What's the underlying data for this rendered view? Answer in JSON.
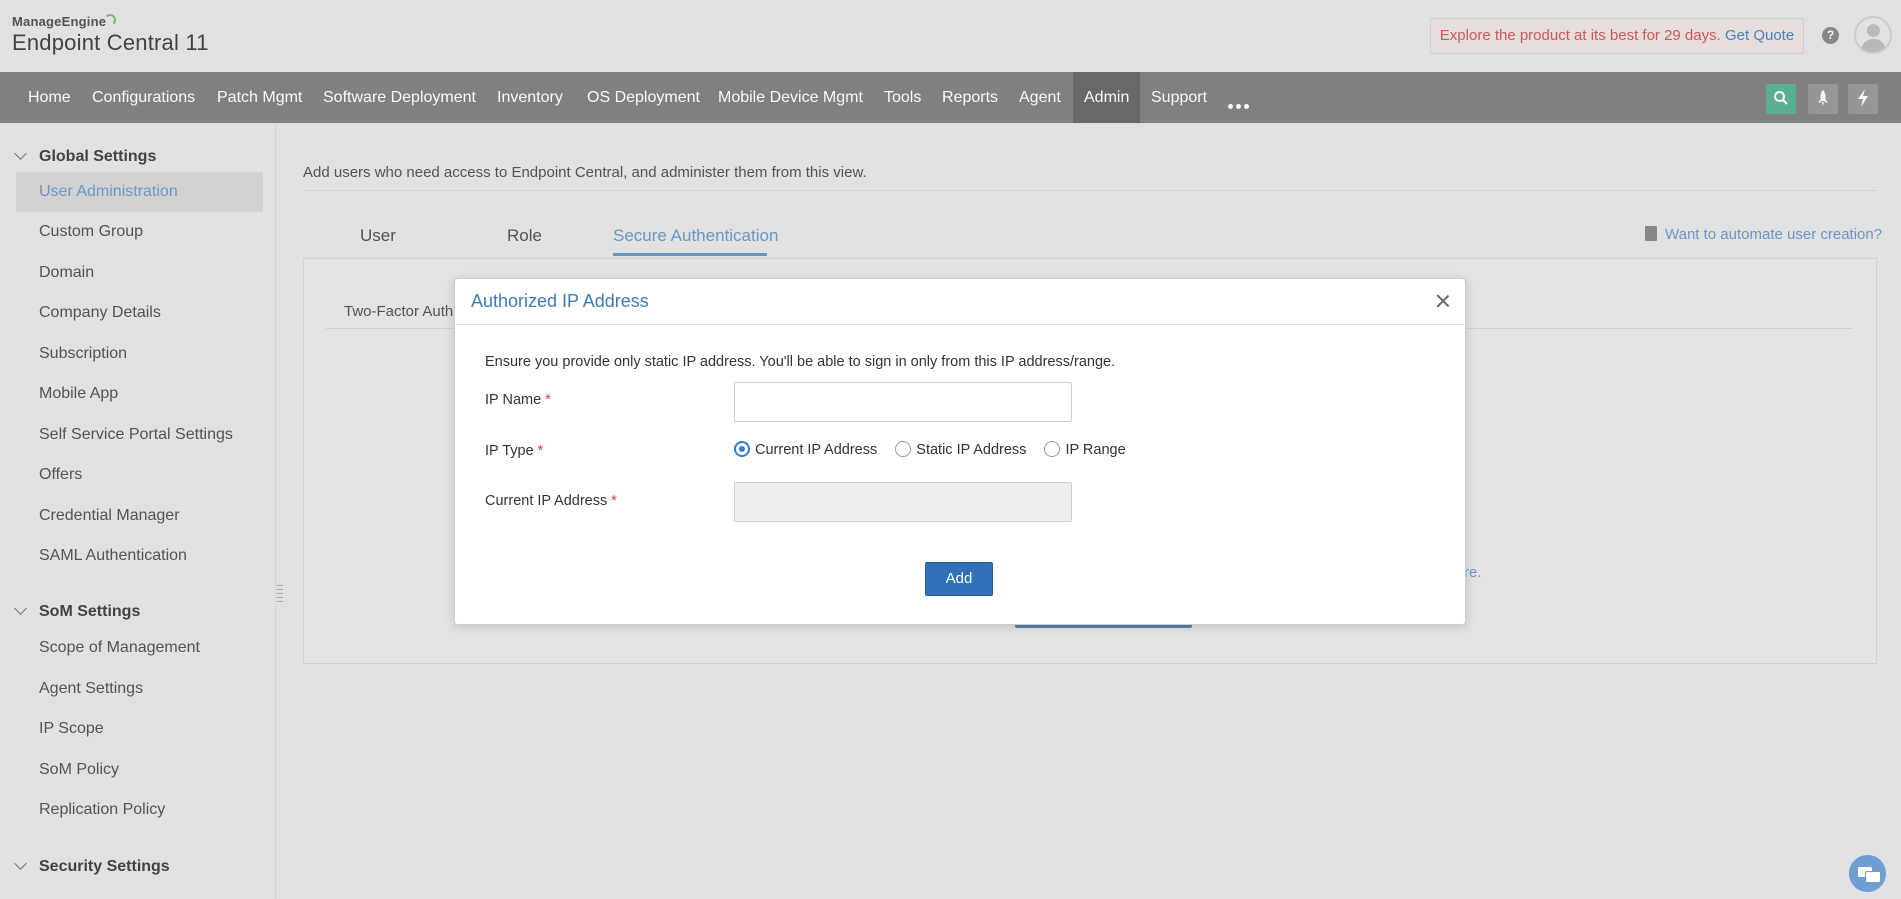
{
  "header": {
    "brand_small": "ManageEngine",
    "product_title": "Endpoint Central 11",
    "trial_text": "Explore the product at its best for 29 days.",
    "trial_link": "Get Quote",
    "help_glyph": "?"
  },
  "nav": {
    "items": [
      {
        "label": "Home"
      },
      {
        "label": "Configurations"
      },
      {
        "label": "Patch Mgmt"
      },
      {
        "label": "Software Deployment"
      },
      {
        "label": "Inventory"
      },
      {
        "label": "OS Deployment"
      },
      {
        "label": "Mobile Device Mgmt"
      },
      {
        "label": "Tools"
      },
      {
        "label": "Reports"
      },
      {
        "label": "Agent"
      },
      {
        "label": "Admin"
      },
      {
        "label": "Support"
      }
    ],
    "active": "Admin",
    "icons": [
      "more-icon",
      "search-icon",
      "rocket-icon",
      "bolt-icon"
    ]
  },
  "sidebar": {
    "sections": [
      {
        "title": "Global Settings",
        "items": [
          "User Administration",
          "Custom Group",
          "Domain",
          "Company Details",
          "Subscription",
          "Mobile App",
          "Self Service Portal Settings",
          "Offers",
          "Credential Manager",
          "SAML Authentication"
        ]
      },
      {
        "title": "SoM Settings",
        "items": [
          "Scope of Management",
          "Agent Settings",
          "IP Scope",
          "SoM Policy",
          "Replication Policy"
        ]
      },
      {
        "title": "Security Settings",
        "items": []
      }
    ],
    "active_item": "User Administration"
  },
  "main": {
    "description": "Add users who need access to Endpoint Central, and administer them from this view.",
    "tabs": [
      {
        "label": "User"
      },
      {
        "label": "Role"
      },
      {
        "label": "Secure Authentication"
      }
    ],
    "active_tab": "Secure Authentication",
    "automate_link": "Want to automate user creation?",
    "subtab_partial": "Two-Factor Authentication",
    "peek_link_text": "re."
  },
  "modal": {
    "title": "Authorized IP Address",
    "note": "Ensure you provide only static IP address. You'll be able to sign in only from this IP address/range.",
    "ip_name_label": "IP Name",
    "ip_name_value": "",
    "ip_type_label": "IP Type",
    "ip_type_options": [
      "Current IP Address",
      "Static IP Address",
      "IP Range"
    ],
    "ip_type_selected": "Current IP Address",
    "current_ip_label": "Current IP Address",
    "current_ip_value": "",
    "required_marker": "*",
    "add_button": "Add"
  },
  "colors": {
    "accent": "#6b9bc8",
    "nav_bg": "#838383",
    "primary_button": "#2f70b8",
    "trial_text": "#d45a5a",
    "search_button": "#5db394"
  }
}
